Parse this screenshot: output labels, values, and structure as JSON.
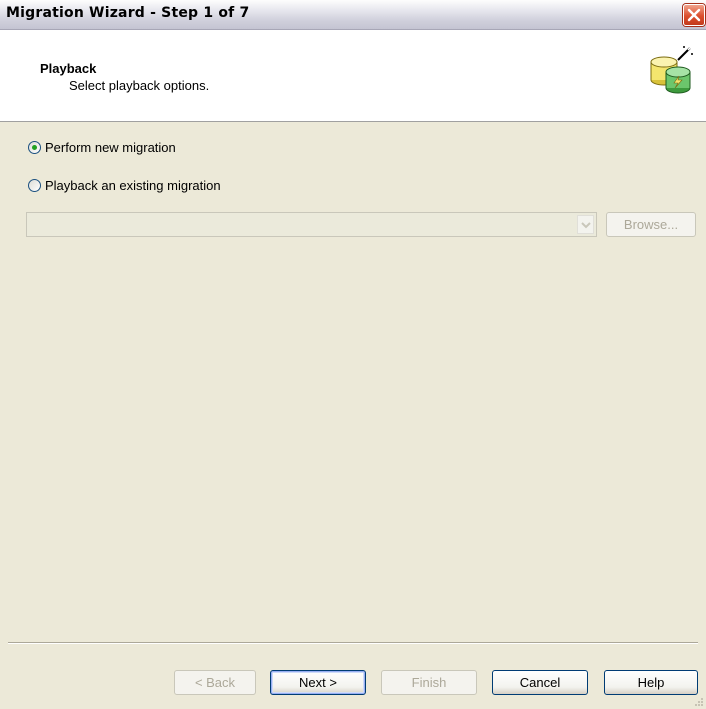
{
  "window": {
    "title": "Migration Wizard - Step 1 of 7",
    "close_icon": "close-icon"
  },
  "header": {
    "title": "Playback",
    "subtitle": "Select playback options.",
    "icon": "database-wizard-icon"
  },
  "options": {
    "perform_new": {
      "label": "Perform new migration",
      "checked": true
    },
    "playback_existing": {
      "label": "Playback an existing migration",
      "checked": false
    }
  },
  "playback_file": {
    "value": "",
    "enabled": false
  },
  "buttons": {
    "browse": "Browse...",
    "back": "< Back",
    "next": "Next >",
    "finish": "Finish",
    "cancel": "Cancel",
    "help": "Help"
  },
  "colors": {
    "close_button": "#dc4f2e",
    "radio_dot": "#21a121",
    "default_button_border": "#003c74"
  }
}
